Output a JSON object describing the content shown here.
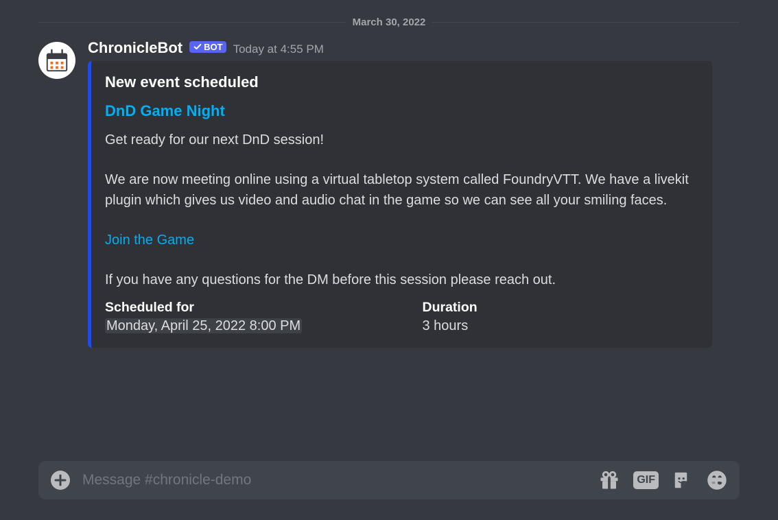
{
  "divider": {
    "date": "March 30, 2022"
  },
  "message": {
    "author": "ChronicleBot",
    "bot_label": "BOT",
    "timestamp": "Today at 4:55 PM"
  },
  "embed": {
    "heading": "New event scheduled",
    "title": "DnD Game Night",
    "desc_p1": "Get ready for our next DnD session!",
    "desc_p2": "We are now meeting online using a virtual tabletop system called FoundryVTT. We have a livekit plugin which gives us video and audio chat in the game so we can see all your smiling faces.",
    "link_text": "Join the Game",
    "desc_p3": "If you have any questions for the DM before this session please reach out.",
    "fields": {
      "scheduled": {
        "name": "Scheduled for",
        "value": "Monday, April 25, 2022 8:00 PM"
      },
      "duration": {
        "name": "Duration",
        "value": "3 hours"
      }
    }
  },
  "compose": {
    "placeholder": "Message #chronicle-demo",
    "gif_label": "GIF"
  }
}
